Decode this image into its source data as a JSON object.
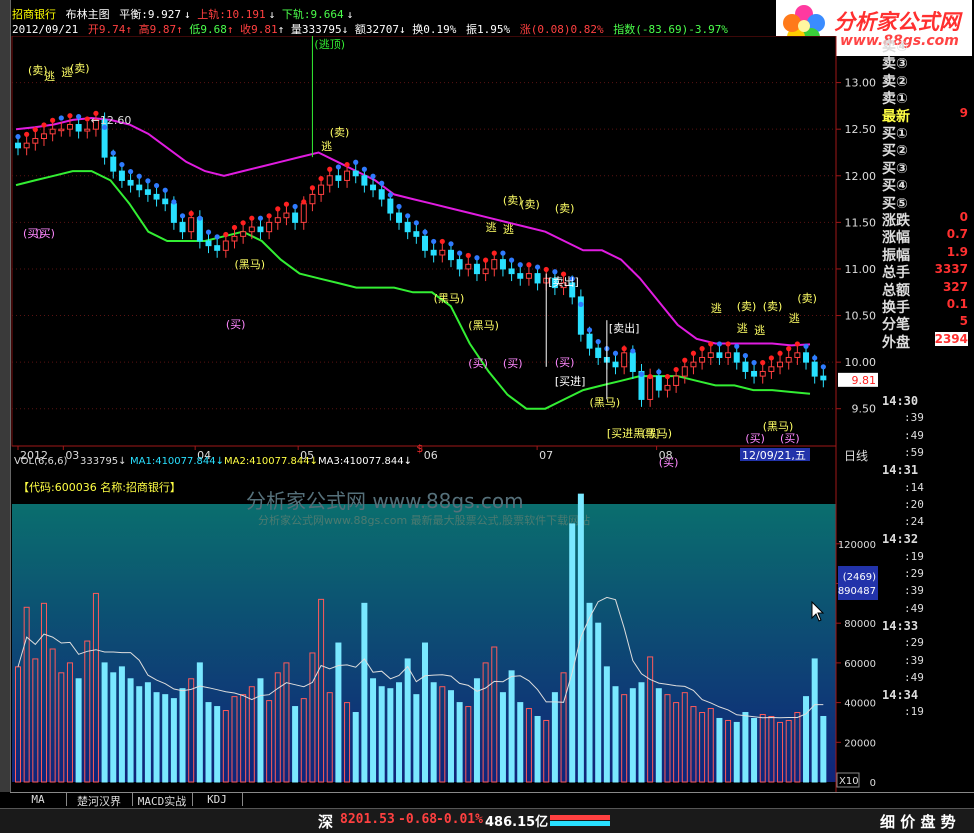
{
  "header": {
    "stock": "招商银行",
    "indicator": "布林主图",
    "balance_label": "平衡:9.927",
    "upper_label": "上轨:10.191",
    "lower_label": "下轨:9.664"
  },
  "row2": {
    "date": "2012/09/21",
    "open": "开9.74",
    "high": "高9.87",
    "low": "低9.68",
    "close": "收9.81",
    "volume": "量333795",
    "amount": "额32707",
    "turnover": "换0.19%",
    "amplitude": "振1.95%",
    "change": "涨(0.08)0.82%",
    "index": "指数(-83.69)-3.97%"
  },
  "logo": {
    "title": "分析家公式网",
    "url": "www.88gs.com"
  },
  "quote": {
    "rows": [
      {
        "label": "卖④",
        "value": ""
      },
      {
        "label": "卖③",
        "value": ""
      },
      {
        "label": "卖②",
        "value": ""
      },
      {
        "label": "卖①",
        "value": ""
      },
      {
        "label": "最新",
        "value": "9"
      },
      {
        "label": "买①",
        "value": ""
      },
      {
        "label": "买②",
        "value": ""
      },
      {
        "label": "买③",
        "value": ""
      },
      {
        "label": "买④",
        "value": ""
      },
      {
        "label": "买⑤",
        "value": ""
      },
      {
        "label": "涨跌",
        "value": "0"
      },
      {
        "label": "涨幅",
        "value": "0.7"
      },
      {
        "label": "振幅",
        "value": "1.9"
      },
      {
        "label": "总手",
        "value": "3337"
      },
      {
        "label": "总额",
        "value": "327"
      },
      {
        "label": "换手",
        "value": "0.1"
      },
      {
        "label": "分笔",
        "value": "5"
      },
      {
        "label": "外盘",
        "value": "2394"
      }
    ],
    "times": [
      {
        "t": "14:30",
        "big": true
      },
      {
        "t": ":39"
      },
      {
        "t": ":49"
      },
      {
        "t": ":59"
      },
      {
        "t": "14:31",
        "big": true
      },
      {
        "t": ":14"
      },
      {
        "t": ":20"
      },
      {
        "t": ":24"
      },
      {
        "t": "14:32",
        "big": true
      },
      {
        "t": ":19"
      },
      {
        "t": ":29"
      },
      {
        "t": ":39"
      },
      {
        "t": ":49"
      },
      {
        "t": "14:33",
        "big": true
      },
      {
        "t": ":29"
      },
      {
        "t": ":39"
      },
      {
        "t": ":49"
      },
      {
        "t": "14:34",
        "big": true
      },
      {
        "t": ":19"
      }
    ]
  },
  "vol_header": {
    "label": "VOL(6,6,6)",
    "value": "333795",
    "ma1": "MA1:410077.844",
    "ma2": "MA2:410077.844",
    "ma3": "MA3:410077.844",
    "code_line": "【代码:600036 名称:招商银行】",
    "watermark1": "分析家公式网 www.88gs.com",
    "watermark2": "分析家公式网www.88gs.com 最新最大股票公式,股票软件下载网站"
  },
  "vol_axis": {
    "ticks": [
      "120000",
      "100000",
      "80000",
      "60000",
      "40000",
      "20000",
      "0"
    ],
    "scale": "X10",
    "box1": "(2469)",
    "box2": "890487"
  },
  "cursor_date": "12/09/21,五",
  "period_label": "日线",
  "price_marker": "9.81",
  "annotations": {
    "top_label": "逃顶",
    "price_label": "12.60",
    "sell": "卖",
    "buy": "买",
    "escape": "逃",
    "dark_horse": "黑马",
    "sell_out": "卖出",
    "buy_in": "买进",
    "buy_in_dark": "买进黑马",
    "dollar": "$"
  },
  "tabs": [
    "MA",
    "楚河汉界",
    "MACD实战",
    "KDJ"
  ],
  "status": {
    "market": "深",
    "index": "8201.53",
    "change": "-0.68",
    "pct": "-0.01%",
    "amount": "486.15亿",
    "right": "细 价 盘 势"
  },
  "chart_data": {
    "type": "candlestick",
    "title": "",
    "x_labels": [
      "2012",
      "03",
      "04",
      "05",
      "06",
      "07",
      "08"
    ],
    "y_ticks": [
      "13.00",
      "12.50",
      "12.00",
      "11.50",
      "11.00",
      "10.50",
      "10.00",
      "9.50"
    ],
    "ylim": [
      9.1,
      13.5
    ],
    "close_series": [
      12.3,
      12.35,
      12.4,
      12.45,
      12.5,
      12.5,
      12.55,
      12.48,
      12.5,
      12.6,
      12.2,
      12.05,
      11.95,
      11.9,
      11.85,
      11.8,
      11.75,
      11.7,
      11.5,
      11.4,
      11.55,
      11.3,
      11.25,
      11.2,
      11.3,
      11.35,
      11.4,
      11.45,
      11.4,
      11.5,
      11.55,
      11.6,
      11.5,
      11.7,
      11.8,
      11.9,
      12.0,
      11.95,
      12.05,
      12.0,
      11.9,
      11.85,
      11.75,
      11.6,
      11.5,
      11.4,
      11.35,
      11.2,
      11.15,
      11.2,
      11.1,
      11.0,
      11.05,
      10.95,
      11.0,
      11.1,
      11.0,
      10.95,
      10.9,
      10.95,
      10.85,
      10.9,
      10.8,
      10.85,
      10.7,
      10.3,
      10.15,
      10.05,
      10.0,
      9.95,
      10.1,
      9.9,
      9.6,
      9.85,
      9.7,
      9.75,
      9.85,
      9.95,
      10.0,
      10.05,
      10.1,
      10.05,
      10.1,
      10.0,
      9.9,
      9.85,
      9.9,
      9.95,
      10.0,
      10.05,
      10.1,
      10.0,
      9.85,
      9.81
    ],
    "upper_band": [
      12.5,
      12.52,
      12.55,
      12.6,
      12.62,
      12.6,
      12.55,
      12.45,
      12.3,
      12.15,
      12.05,
      12.0,
      12.05,
      12.1,
      12.15,
      12.2,
      12.25,
      12.15,
      12.05,
      11.95,
      11.8,
      11.75,
      11.7,
      11.65,
      11.6,
      11.55,
      11.5,
      11.45,
      11.4,
      11.3,
      11.2,
      11.2,
      11.1,
      10.9,
      10.65,
      10.4,
      10.25,
      10.2,
      10.2,
      10.2,
      10.2,
      10.18,
      10.19
    ],
    "lower_band": [
      11.9,
      11.95,
      12.0,
      12.05,
      12.05,
      11.95,
      11.7,
      11.4,
      11.3,
      11.3,
      11.3,
      11.35,
      11.4,
      11.3,
      11.1,
      10.95,
      10.9,
      10.85,
      10.8,
      10.8,
      10.8,
      10.75,
      10.75,
      10.6,
      10.2,
      9.9,
      9.65,
      9.5,
      9.5,
      9.6,
      9.7,
      9.75,
      9.8,
      9.85,
      9.85,
      9.85,
      9.8,
      9.75,
      9.75,
      9.7,
      9.7,
      9.68,
      9.66
    ],
    "volume_series": [
      58000,
      88000,
      62000,
      90000,
      67000,
      55000,
      60000,
      52000,
      71000,
      95000,
      60000,
      55000,
      58000,
      52000,
      48000,
      50000,
      45000,
      44000,
      42000,
      47000,
      52000,
      60000,
      40000,
      38000,
      36000,
      43000,
      44000,
      48000,
      52000,
      41000,
      55000,
      60000,
      38000,
      42000,
      65000,
      92000,
      45000,
      70000,
      40000,
      35000,
      90000,
      52000,
      48000,
      47000,
      50000,
      62000,
      44000,
      70000,
      50000,
      48000,
      46000,
      40000,
      38000,
      52000,
      60000,
      68000,
      45000,
      56000,
      40000,
      37000,
      33000,
      31000,
      45000,
      55000,
      130000,
      145000,
      90000,
      80000,
      58000,
      48000,
      44000,
      47000,
      50000,
      63000,
      47000,
      44000,
      40000,
      45000,
      38000,
      35000,
      37000,
      32000,
      31000,
      30000,
      35000,
      32000,
      34000,
      33000,
      30000,
      31000,
      35000,
      43000,
      62000,
      33000
    ],
    "volume_ylim": [
      0,
      135000
    ]
  }
}
